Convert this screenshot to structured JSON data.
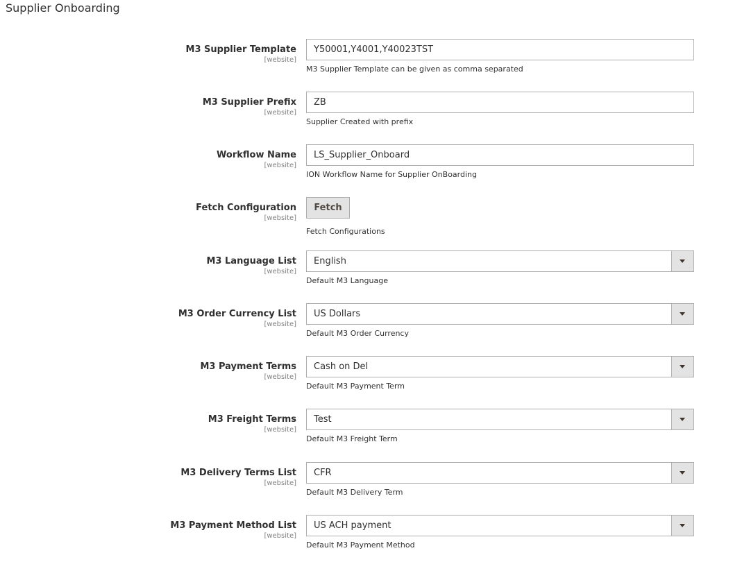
{
  "section": {
    "title": "Supplier Onboarding"
  },
  "fields": [
    {
      "label": "M3 Supplier Template",
      "scope": "[website]",
      "value": "Y50001,Y4001,Y40023TST",
      "note": "M3 Supplier Template can be given as comma separated"
    },
    {
      "label": "M3 Supplier Prefix",
      "scope": "[website]",
      "value": "ZB",
      "note": "Supplier Created with prefix"
    },
    {
      "label": "Workflow Name",
      "scope": "[website]",
      "value": "LS_Supplier_Onboard",
      "note": "ION Workflow Name for Supplier OnBoarding"
    },
    {
      "label": "Fetch Configuration",
      "scope": "[website]",
      "button_label": "Fetch",
      "note": "Fetch Configurations"
    },
    {
      "label": "M3 Language List",
      "scope": "[website]",
      "value": "English",
      "note": "Default M3 Language"
    },
    {
      "label": "M3 Order Currency List",
      "scope": "[website]",
      "value": "US Dollars",
      "note": "Default M3 Order Currency"
    },
    {
      "label": "M3 Payment Terms",
      "scope": "[website]",
      "value": "Cash on Del",
      "note": "Default M3 Payment Term"
    },
    {
      "label": "M3 Freight Terms",
      "scope": "[website]",
      "value": "Test",
      "note": "Default M3 Freight Term"
    },
    {
      "label": "M3 Delivery Terms List",
      "scope": "[website]",
      "value": "CFR",
      "note": "Default M3 Delivery Term"
    },
    {
      "label": "M3 Payment Method List",
      "scope": "[website]",
      "value": "US ACH payment",
      "note": "Default M3 Payment Method"
    }
  ],
  "icons": {
    "select_arrow": "chevron-down-icon"
  }
}
